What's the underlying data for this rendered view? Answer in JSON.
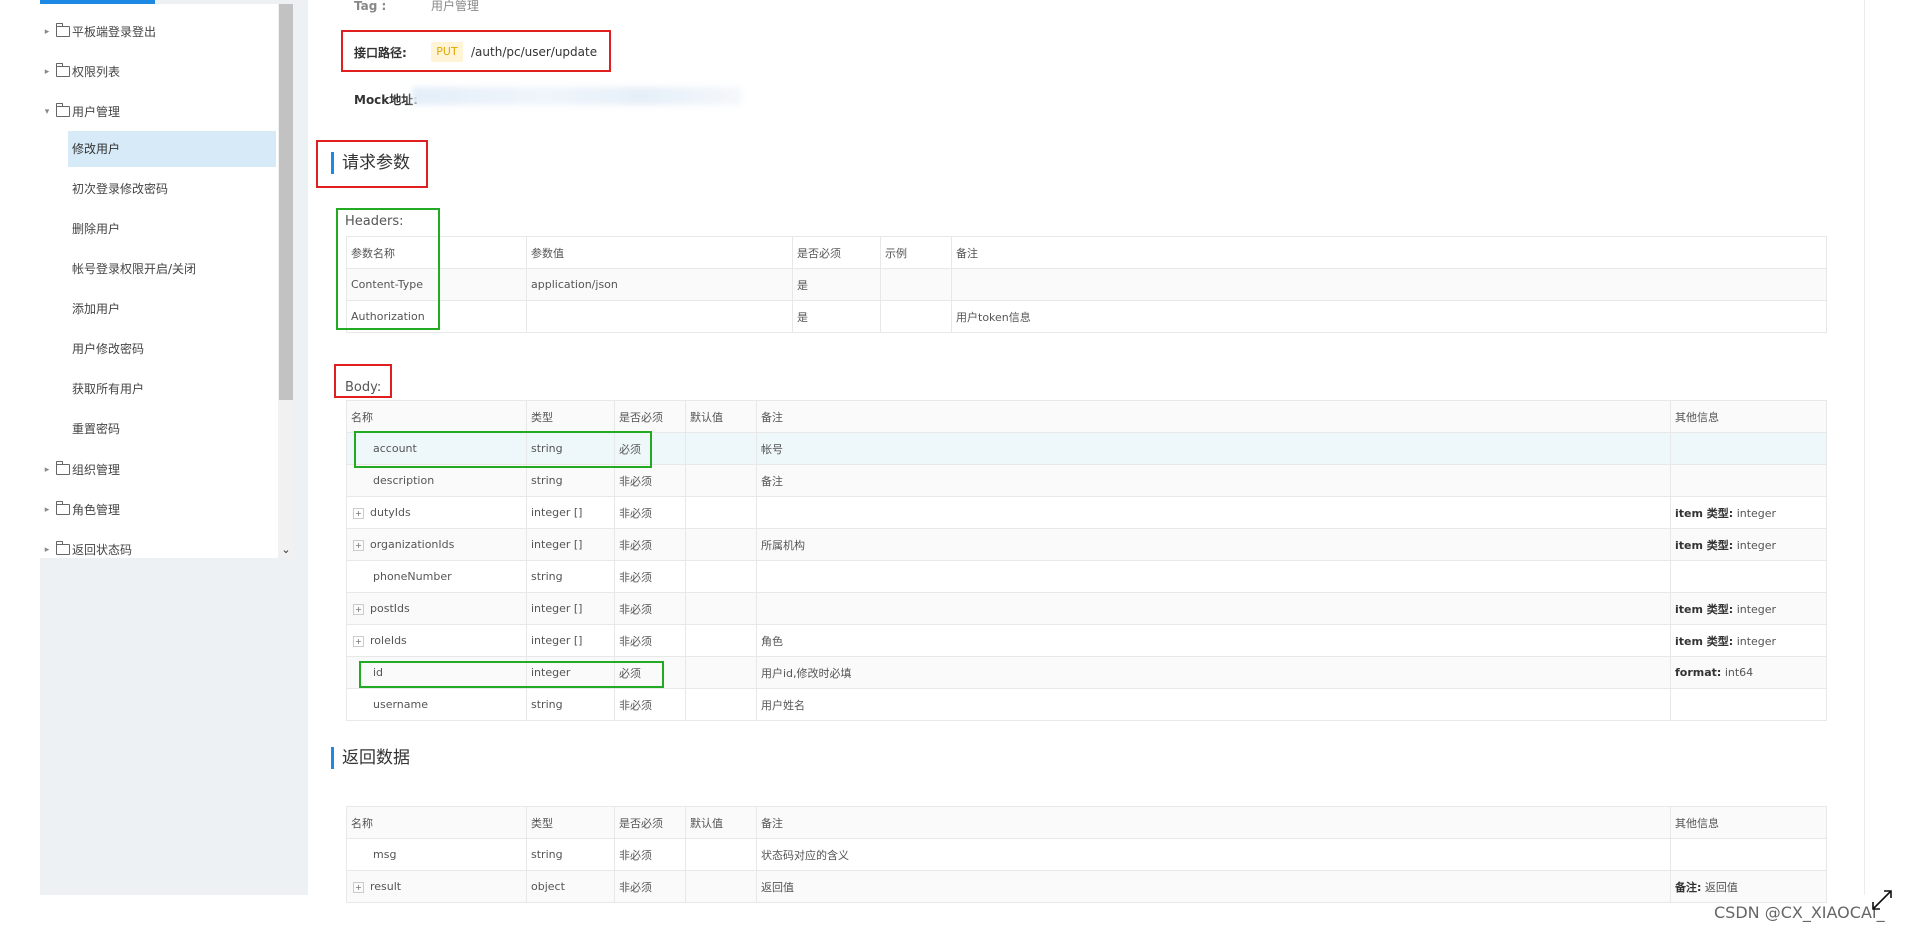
{
  "sidebar": {
    "items": [
      {
        "label": "平板端登录登出",
        "kind": "folder",
        "expanded": false
      },
      {
        "label": "权限列表",
        "kind": "folder",
        "expanded": false
      },
      {
        "label": "用户管理",
        "kind": "folder",
        "expanded": true
      },
      {
        "label": "修改用户",
        "kind": "child",
        "active": true
      },
      {
        "label": "初次登录修改密码",
        "kind": "child"
      },
      {
        "label": "删除用户",
        "kind": "child"
      },
      {
        "label": "帐号登录权限开启/关闭",
        "kind": "child"
      },
      {
        "label": "添加用户",
        "kind": "child"
      },
      {
        "label": "用户修改密码",
        "kind": "child"
      },
      {
        "label": "获取所有用户",
        "kind": "child"
      },
      {
        "label": "重置密码",
        "kind": "child"
      },
      {
        "label": "组织管理",
        "kind": "folder",
        "expanded": false
      },
      {
        "label": "角色管理",
        "kind": "folder",
        "expanded": false
      },
      {
        "label": "返回状态码",
        "kind": "folder",
        "expanded": false
      }
    ]
  },
  "api": {
    "tag_label": "Tag :",
    "tag_value": "用户管理",
    "path_label": "接口路径:",
    "method": "PUT",
    "path": "/auth/pc/user/update",
    "mock_label": "Mock地址:"
  },
  "request": {
    "title": "请求参数",
    "headers_title": "Headers:",
    "headers_columns": [
      "参数名称",
      "参数值",
      "是否必须",
      "示例",
      "备注"
    ],
    "headers_rows": [
      [
        "Content-Type",
        "application/json",
        "是",
        "",
        ""
      ],
      [
        "Authorization",
        "",
        "是",
        "",
        "用户token信息"
      ]
    ],
    "body_title": "Body:",
    "body_columns": [
      "名称",
      "类型",
      "是否必须",
      "默认值",
      "备注",
      "其他信息"
    ],
    "body_rows": [
      {
        "name": "account",
        "type": "string",
        "required": "必须",
        "default": "",
        "note": "帐号",
        "extra_key": "",
        "extra_val": "",
        "expandable": false,
        "highlight": true
      },
      {
        "name": "description",
        "type": "string",
        "required": "非必须",
        "default": "",
        "note": "备注",
        "extra_key": "",
        "extra_val": "",
        "expandable": false
      },
      {
        "name": "dutyIds",
        "type": "integer []",
        "required": "非必须",
        "default": "",
        "note": "",
        "extra_key": "item 类型:",
        "extra_val": "integer",
        "expandable": true
      },
      {
        "name": "organizationIds",
        "type": "integer []",
        "required": "非必须",
        "default": "",
        "note": "所属机构",
        "extra_key": "item 类型:",
        "extra_val": "integer",
        "expandable": true
      },
      {
        "name": "phoneNumber",
        "type": "string",
        "required": "非必须",
        "default": "",
        "note": "",
        "extra_key": "",
        "extra_val": "",
        "expandable": false
      },
      {
        "name": "postIds",
        "type": "integer []",
        "required": "非必须",
        "default": "",
        "note": "",
        "extra_key": "item 类型:",
        "extra_val": "integer",
        "expandable": true
      },
      {
        "name": "roleIds",
        "type": "integer []",
        "required": "非必须",
        "default": "",
        "note": "角色",
        "extra_key": "item 类型:",
        "extra_val": "integer",
        "expandable": true
      },
      {
        "name": "id",
        "type": "integer",
        "required": "必须",
        "default": "",
        "note": "用户id,修改时必填",
        "extra_key": "format:",
        "extra_val": "int64",
        "expandable": false
      },
      {
        "name": "username",
        "type": "string",
        "required": "非必须",
        "default": "",
        "note": "用户姓名",
        "extra_key": "",
        "extra_val": "",
        "expandable": false
      }
    ]
  },
  "response": {
    "title": "返回数据",
    "columns": [
      "名称",
      "类型",
      "是否必须",
      "默认值",
      "备注",
      "其他信息"
    ],
    "rows": [
      {
        "name": "msg",
        "type": "string",
        "required": "非必须",
        "default": "",
        "note": "状态码对应的含义",
        "extra_key": "",
        "extra_val": "",
        "expandable": false
      },
      {
        "name": "result",
        "type": "object",
        "required": "非必须",
        "default": "",
        "note": "返回值",
        "extra_key": "备注:",
        "extra_val": "返回值",
        "expandable": true
      }
    ]
  },
  "watermark": "CSDN @CX_XIAOCAI_",
  "colors": {
    "accent": "#1e88e5",
    "put_badge": "#fff4d6",
    "annotation_red": "#e02020",
    "annotation_green": "#22aa22"
  }
}
